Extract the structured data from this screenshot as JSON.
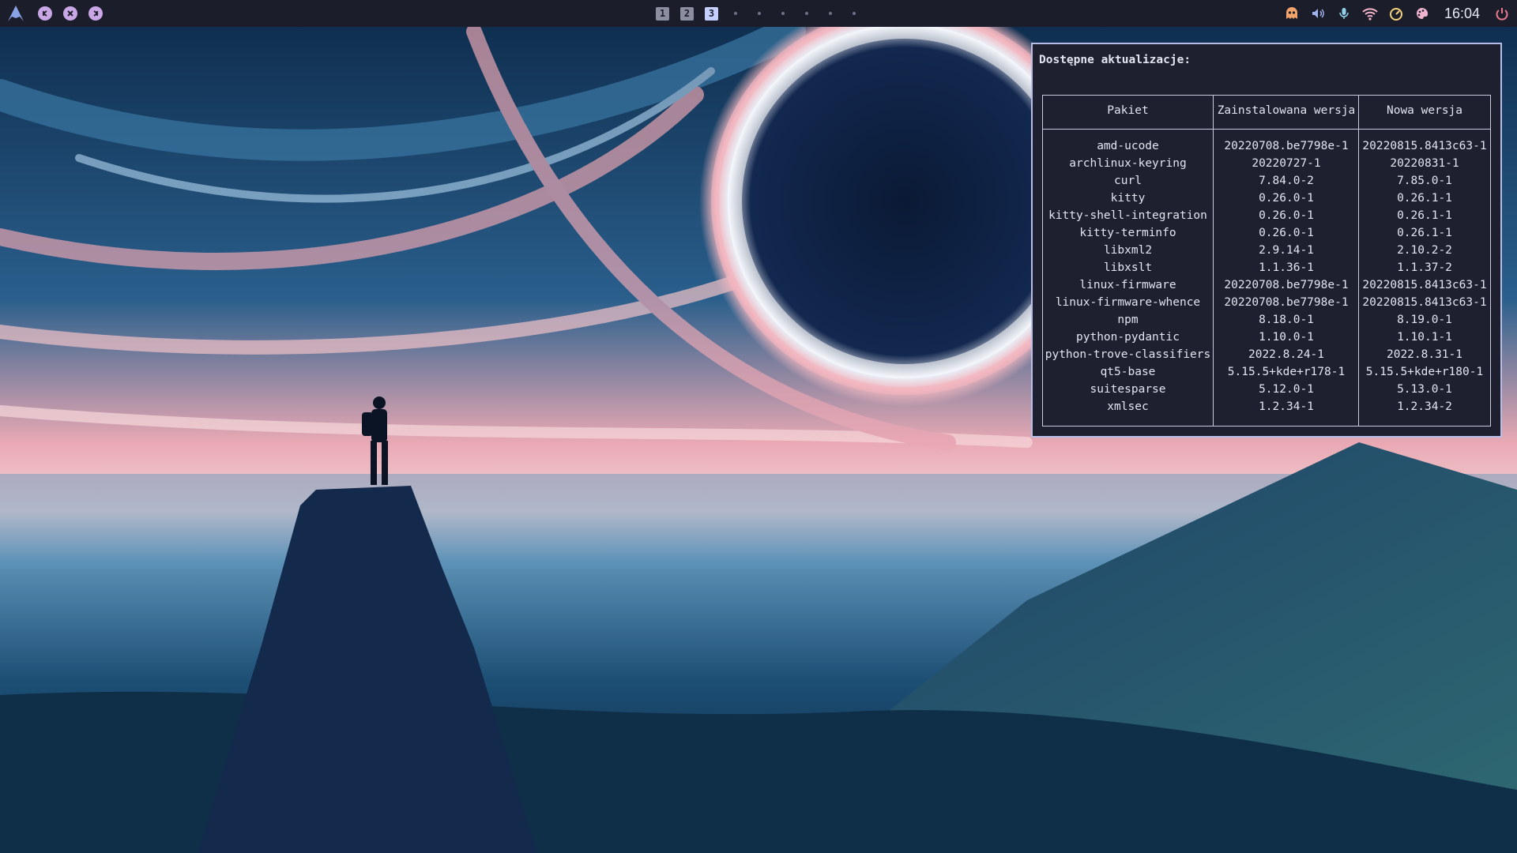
{
  "topbar": {
    "logo_icon": "arch-linux-logo-icon",
    "window_controls": [
      {
        "name": "minimize-button",
        "icon": "minimize-icon"
      },
      {
        "name": "close-button",
        "icon": "close-icon"
      },
      {
        "name": "maximize-button",
        "icon": "maximize-icon"
      }
    ],
    "workspaces": [
      "1",
      "2",
      "3"
    ],
    "active_workspace": "3",
    "clock": "16:04",
    "tray_icons": [
      "ghost-icon",
      "volume-icon",
      "microphone-icon",
      "wifi-icon",
      "speedometer-icon",
      "palette-icon",
      "power-icon"
    ],
    "colors": {
      "bar_bg": "#1c1d2b",
      "accent": "#c9a7e6",
      "power": "#e8788b"
    }
  },
  "updates": {
    "title": "Dostępne aktualizacje:",
    "columns": [
      "Pakiet",
      "Zainstalowana wersja",
      "Nowa wersja"
    ],
    "rows": [
      [
        "amd-ucode",
        "20220708.be7798e-1",
        "20220815.8413c63-1"
      ],
      [
        "archlinux-keyring",
        "20220727-1",
        "20220831-1"
      ],
      [
        "curl",
        "7.84.0-2",
        "7.85.0-1"
      ],
      [
        "kitty",
        "0.26.0-1",
        "0.26.1-1"
      ],
      [
        "kitty-shell-integration",
        "0.26.0-1",
        "0.26.1-1"
      ],
      [
        "kitty-terminfo",
        "0.26.0-1",
        "0.26.1-1"
      ],
      [
        "libxml2",
        "2.9.14-1",
        "2.10.2-2"
      ],
      [
        "libxslt",
        "1.1.36-1",
        "1.1.37-2"
      ],
      [
        "linux-firmware",
        "20220708.be7798e-1",
        "20220815.8413c63-1"
      ],
      [
        "linux-firmware-whence",
        "20220708.be7798e-1",
        "20220815.8413c63-1"
      ],
      [
        "npm",
        "8.18.0-1",
        "8.19.0-1"
      ],
      [
        "python-pydantic",
        "1.10.0-1",
        "1.10.1-1"
      ],
      [
        "python-trove-classifiers",
        "2022.8.24-1",
        "2022.8.31-1"
      ],
      [
        "qt5-base",
        "5.15.5+kde+r178-1",
        "5.15.5+kde+r180-1"
      ],
      [
        "suitesparse",
        "5.12.0-1",
        "5.13.0-1"
      ],
      [
        "xmlsec",
        "1.2.34-1",
        "1.2.34-2"
      ]
    ]
  }
}
